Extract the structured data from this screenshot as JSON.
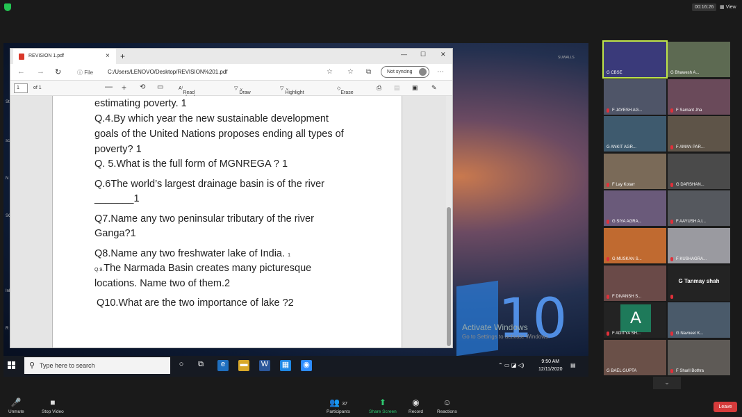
{
  "zoom_top": {
    "timer": "00:16:26",
    "view_label": "View"
  },
  "desktop": {
    "watermark": "SUWALLS",
    "win10_text": "10",
    "activate_title": "Activate Windows",
    "activate_sub": "Go to Settings to activate Windows.",
    "left_labels": [
      "St",
      "sc",
      "N",
      "SC",
      "Ink",
      "R"
    ]
  },
  "edge": {
    "tab_title": "REVISION 1.pdf",
    "new_tab": "+",
    "file_label": "File",
    "url": "C:/Users/LENOVO/Desktop/REVISION%201.pdf",
    "sync_label": "Not syncing",
    "page_number": "1",
    "page_total": "of 1",
    "toolbar": {
      "read_aloud": "Read aloud",
      "draw": "Draw",
      "highlight": "Highlight",
      "erase": "Erase"
    }
  },
  "document": {
    "lines": [
      "estimating poverty.  1",
      "Q.4.By which year the new sustainable development",
      "goals of the United Nations proposes ending all types of",
      "poverty?  1",
      "Q. 5.What is the full form of MGNREGA ?    1",
      "Q.6The world’s largest drainage basin is of the river",
      "_______1",
      "Q7.Name any two peninsular tributary of the river",
      "Ganga?1",
      "Q8.Name any two freshwater lake of India.",
      "The Narmada Basin creates many picturesque",
      "locations. Name two of them.2",
      "Q10.What are the two  importance of lake ?2"
    ],
    "q8_mark": "1",
    "q9_prefix": "Q.9."
  },
  "taskbar": {
    "search_placeholder": "Type here to search",
    "time": "9:50 AM",
    "date": "12/11/2020"
  },
  "participants": [
    {
      "name": "G CBSE",
      "color": "#3a3a7a",
      "muted": false
    },
    {
      "name": "G Bhawesh A...",
      "color": "#5d6a52",
      "muted": false
    },
    {
      "name": "F JAYESH AG...",
      "color": "#4f5568",
      "muted": true
    },
    {
      "name": "F Samant Jha",
      "color": "#6a4a5a",
      "muted": true
    },
    {
      "name": "G ANKIT AGR...",
      "color": "#3e5a6e",
      "muted": false
    },
    {
      "name": "F AMAN PAR...",
      "color": "#5e5448",
      "muted": true
    },
    {
      "name": "F Lay Kotarr",
      "color": "#7a6a58",
      "muted": true
    },
    {
      "name": "G DARSHAN...",
      "color": "#4a4a4a",
      "muted": true
    },
    {
      "name": "G SIYA AGRA...",
      "color": "#6a5a7a",
      "muted": true
    },
    {
      "name": "F AAYUSH A.I...",
      "color": "#55585e",
      "muted": true
    },
    {
      "name": "G MUSKAN S...",
      "color": "#c06a30",
      "muted": true
    },
    {
      "name": "F KUSHAGRA...",
      "color": "#9a9aa0",
      "muted": true
    },
    {
      "name": "F DIVANSH S...",
      "color": "#6a4a48",
      "muted": true
    },
    {
      "name": "G Tanmay shah",
      "color": "#232323",
      "muted": true
    },
    {
      "name": "F ADITYA SH...",
      "color": "#232323",
      "muted": true
    },
    {
      "name": "G Navneet K...",
      "color": "#4a5a6a",
      "muted": true
    },
    {
      "name": "G BAEL GUPTA",
      "color": "#6a5048",
      "muted": false
    },
    {
      "name": "F Sharil Bothra",
      "color": "#5e5a56",
      "muted": true
    }
  ],
  "aditya_initial": "A",
  "controls": {
    "unmute": "Unmute",
    "stop_video": "Stop Video",
    "participants": "Participants",
    "participants_count": "37",
    "share_screen": "Share Screen",
    "record": "Record",
    "reactions": "Reactions",
    "leave": "Leave"
  }
}
